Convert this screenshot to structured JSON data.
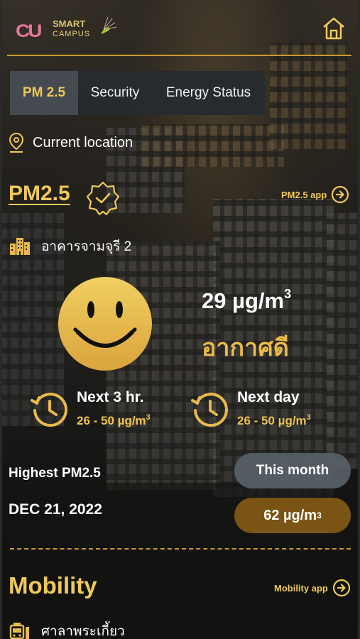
{
  "header": {
    "logo_mark": "CU",
    "logo_line1": "SMART",
    "logo_line2": "CAMPUS",
    "home_icon": "home-icon"
  },
  "tabs": [
    {
      "label": "PM 2.5",
      "active": true
    },
    {
      "label": "Security",
      "active": false
    },
    {
      "label": "Energy Status",
      "active": false
    }
  ],
  "location": {
    "label": "Current location",
    "icon": "map-pin-icon"
  },
  "pm": {
    "title": "PM2.5",
    "badge_icon": "verified-badge-icon",
    "app_link": "PM2.5 app",
    "building": "อาคารจามจุรี 2",
    "value": "29 µg/m",
    "value_unit_sup": "3",
    "status": "อากาศดี",
    "face_icon": "smiley-face-icon",
    "forecasts": [
      {
        "label": "Next 3 hr.",
        "range": "26 - 50 µg/m",
        "sup": "3",
        "icon": "clock-history-icon"
      },
      {
        "label": "Next day",
        "range": "26 - 50 µg/m",
        "sup": "3",
        "icon": "clock-history-icon"
      }
    ],
    "highest_label": "Highest PM2.5",
    "highest_date": "DEC 21, 2022",
    "period_button": "This month",
    "highest_value": "62 µg/m",
    "highest_value_sup": "3"
  },
  "mobility": {
    "title": "Mobility",
    "app_link": "Mobility app",
    "location": "ศาลาพระเกี้ยว"
  },
  "colors": {
    "accent": "#f0c95a",
    "accent_line": "#c89a2c",
    "status_good": "#e9b94a",
    "value_pill": "#7a5414",
    "month_pill": "#586068"
  }
}
